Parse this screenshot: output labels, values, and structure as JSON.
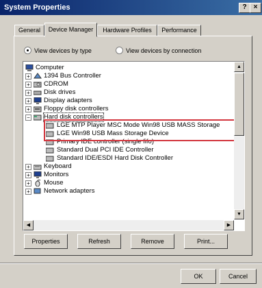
{
  "window": {
    "title": "System Properties",
    "help_glyph": "?",
    "close_glyph": "×"
  },
  "tabs": [
    "General",
    "Device Manager",
    "Hardware Profiles",
    "Performance"
  ],
  "view_options": {
    "by_type": "View devices by type",
    "by_connection": "View devices by connection",
    "selected": "by_type"
  },
  "tree": [
    {
      "label": "Computer",
      "icon": "computer-icon",
      "expander": ""
    },
    {
      "label": "1394 Bus Controller",
      "icon": "controller-icon",
      "expander": "+"
    },
    {
      "label": "CDROM",
      "icon": "cdrom-icon",
      "expander": "+"
    },
    {
      "label": "Disk drives",
      "icon": "disk-icon",
      "expander": "+"
    },
    {
      "label": "Display adapters",
      "icon": "display-icon",
      "expander": "+"
    },
    {
      "label": "Floppy disk controllers",
      "icon": "floppy-icon",
      "expander": "+"
    },
    {
      "label": "Hard disk controllers",
      "icon": "hdd-controller-icon",
      "expander": "−"
    },
    {
      "label": "LGE MTP Player MSC Mode Win98 USB MASS Storage",
      "icon": "storage-icon",
      "expander": ""
    },
    {
      "label": "LGE Win98 USB Mass Storage Device",
      "icon": "storage-icon",
      "expander": ""
    },
    {
      "label": "Primary IDE controller (single fifo)",
      "icon": "storage-icon",
      "expander": ""
    },
    {
      "label": "Standard Dual PCI IDE Controller",
      "icon": "storage-icon",
      "expander": ""
    },
    {
      "label": "Standard IDE/ESDI Hard Disk Controller",
      "icon": "storage-icon",
      "expander": ""
    },
    {
      "label": "Keyboard",
      "icon": "keyboard-icon",
      "expander": "+"
    },
    {
      "label": "Monitors",
      "icon": "monitor-icon",
      "expander": "+"
    },
    {
      "label": "Mouse",
      "icon": "mouse-icon",
      "expander": "+"
    },
    {
      "label": "Network adapters",
      "icon": "network-icon",
      "expander": "+"
    }
  ],
  "panel_buttons": [
    "Properties",
    "Refresh",
    "Remove",
    "Print..."
  ],
  "dialog_buttons": {
    "ok": "OK",
    "cancel": "Cancel"
  },
  "colors": {
    "title_start": "#0a246a",
    "title_end": "#3a6ea5",
    "highlight_box": "#d3363e",
    "face": "#d4d0c8"
  }
}
